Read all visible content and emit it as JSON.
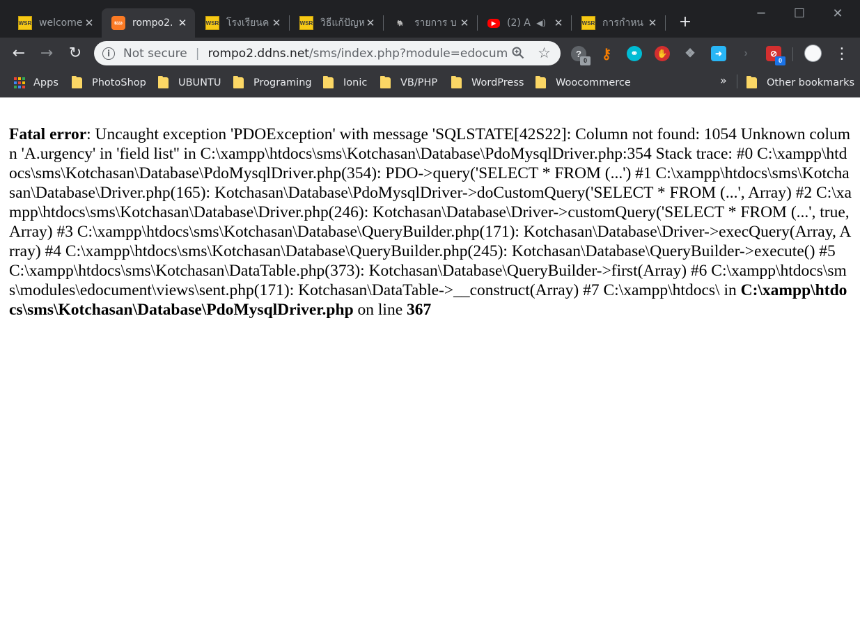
{
  "browser": {
    "tabs": [
      {
        "title": "welcome",
        "favicon": "wsr-icon",
        "active": false
      },
      {
        "title": "rompo2.",
        "favicon": "xampp-icon",
        "active": true
      },
      {
        "title": "โรงเรียนค",
        "favicon": "wsr-icon",
        "active": false
      },
      {
        "title": "วิธีแก้ปัญห",
        "favicon": "wsr-icon",
        "active": false
      },
      {
        "title": "รายการ บ",
        "favicon": "postgres-elephant-icon",
        "active": false
      },
      {
        "title": "(2) A",
        "favicon": "youtube-icon",
        "active": false
      },
      {
        "title": "การกำหน",
        "favicon": "wsr-icon",
        "active": false
      }
    ],
    "favicon_text": "WSR",
    "omnibox": {
      "security_label": "Not secure",
      "separator": "|",
      "url_host": "rompo2.ddns.net",
      "url_path": "/sms/index.php?module=edocumen..."
    },
    "extensions": [
      {
        "name": "shield-question-extension-icon",
        "badge": "0",
        "color": "#9aa0a6"
      },
      {
        "name": "key-extension-icon",
        "badge": "",
        "color": "#f57c00"
      },
      {
        "name": "share-extension-icon",
        "badge": "",
        "color": "#00bcd4"
      },
      {
        "name": "stop-hand-extension-icon",
        "badge": "",
        "color": "#d32f2f"
      },
      {
        "name": "dropbox-extension-icon",
        "badge": "",
        "color": "#9aa0a6"
      },
      {
        "name": "screen-share-extension-icon",
        "badge": "",
        "color": "#29b6f6"
      },
      {
        "name": "chevron-extension-icon",
        "badge": "",
        "color": "#5f6368"
      },
      {
        "name": "block-extension-icon",
        "badge": "0",
        "color": "#d32f2f"
      }
    ],
    "bookmarks": [
      {
        "label": "Apps",
        "icon": "apps-grid-icon"
      },
      {
        "label": "PhotoShop",
        "icon": "folder-icon"
      },
      {
        "label": "UBUNTU",
        "icon": "folder-icon"
      },
      {
        "label": "Programing",
        "icon": "folder-icon"
      },
      {
        "label": "Ionic",
        "icon": "folder-icon"
      },
      {
        "label": "VB/PHP",
        "icon": "folder-icon"
      },
      {
        "label": "WordPress",
        "icon": "folder-icon"
      },
      {
        "label": "Woocommerce",
        "icon": "folder-icon"
      }
    ],
    "bookmarks_overflow": "»",
    "other_bookmarks": "Other bookmarks"
  },
  "page": {
    "error_label": "Fatal error",
    "error_message": ": Uncaught exception 'PDOException' with message 'SQLSTATE[42S22]: Column not found: 1054 Unknown column 'A.urgency' in 'field list'' in C:\\xampp\\htdocs\\sms\\Kotchasan\\Database\\PdoMysqlDriver.php:354 Stack trace: #0 C:\\xampp\\htdocs\\sms\\Kotchasan\\Database\\PdoMysqlDriver.php(354): PDO->query('SELECT * FROM (...') #1 C:\\xampp\\htdocs\\sms\\Kotchasan\\Database\\Driver.php(165): Kotchasan\\Database\\PdoMysqlDriver->doCustomQuery('SELECT * FROM (...', Array) #2 C:\\xampp\\htdocs\\sms\\Kotchasan\\Database\\Driver.php(246): Kotchasan\\Database\\Driver->customQuery('SELECT * FROM (...', true, Array) #3 C:\\xampp\\htdocs\\sms\\Kotchasan\\Database\\QueryBuilder.php(171): Kotchasan\\Database\\Driver->execQuery(Array, Array) #4 C:\\xampp\\htdocs\\sms\\Kotchasan\\Database\\QueryBuilder.php(245): Kotchasan\\Database\\QueryBuilder->execute() #5 C:\\xampp\\htdocs\\sms\\Kotchasan\\DataTable.php(373): Kotchasan\\Database\\QueryBuilder->first(Array) #6 C:\\xampp\\htdocs\\sms\\modules\\edocument\\views\\sent.php(171): Kotchasan\\DataTable->__construct(Array) #7 C:\\xampp\\htdocs\\",
    "in_text": " in ",
    "error_file": "C:\\xampp\\htdocs\\sms\\Kotchasan\\Database\\PdoMysqlDriver.php",
    "on_line_text": " on line ",
    "error_line": "367"
  }
}
